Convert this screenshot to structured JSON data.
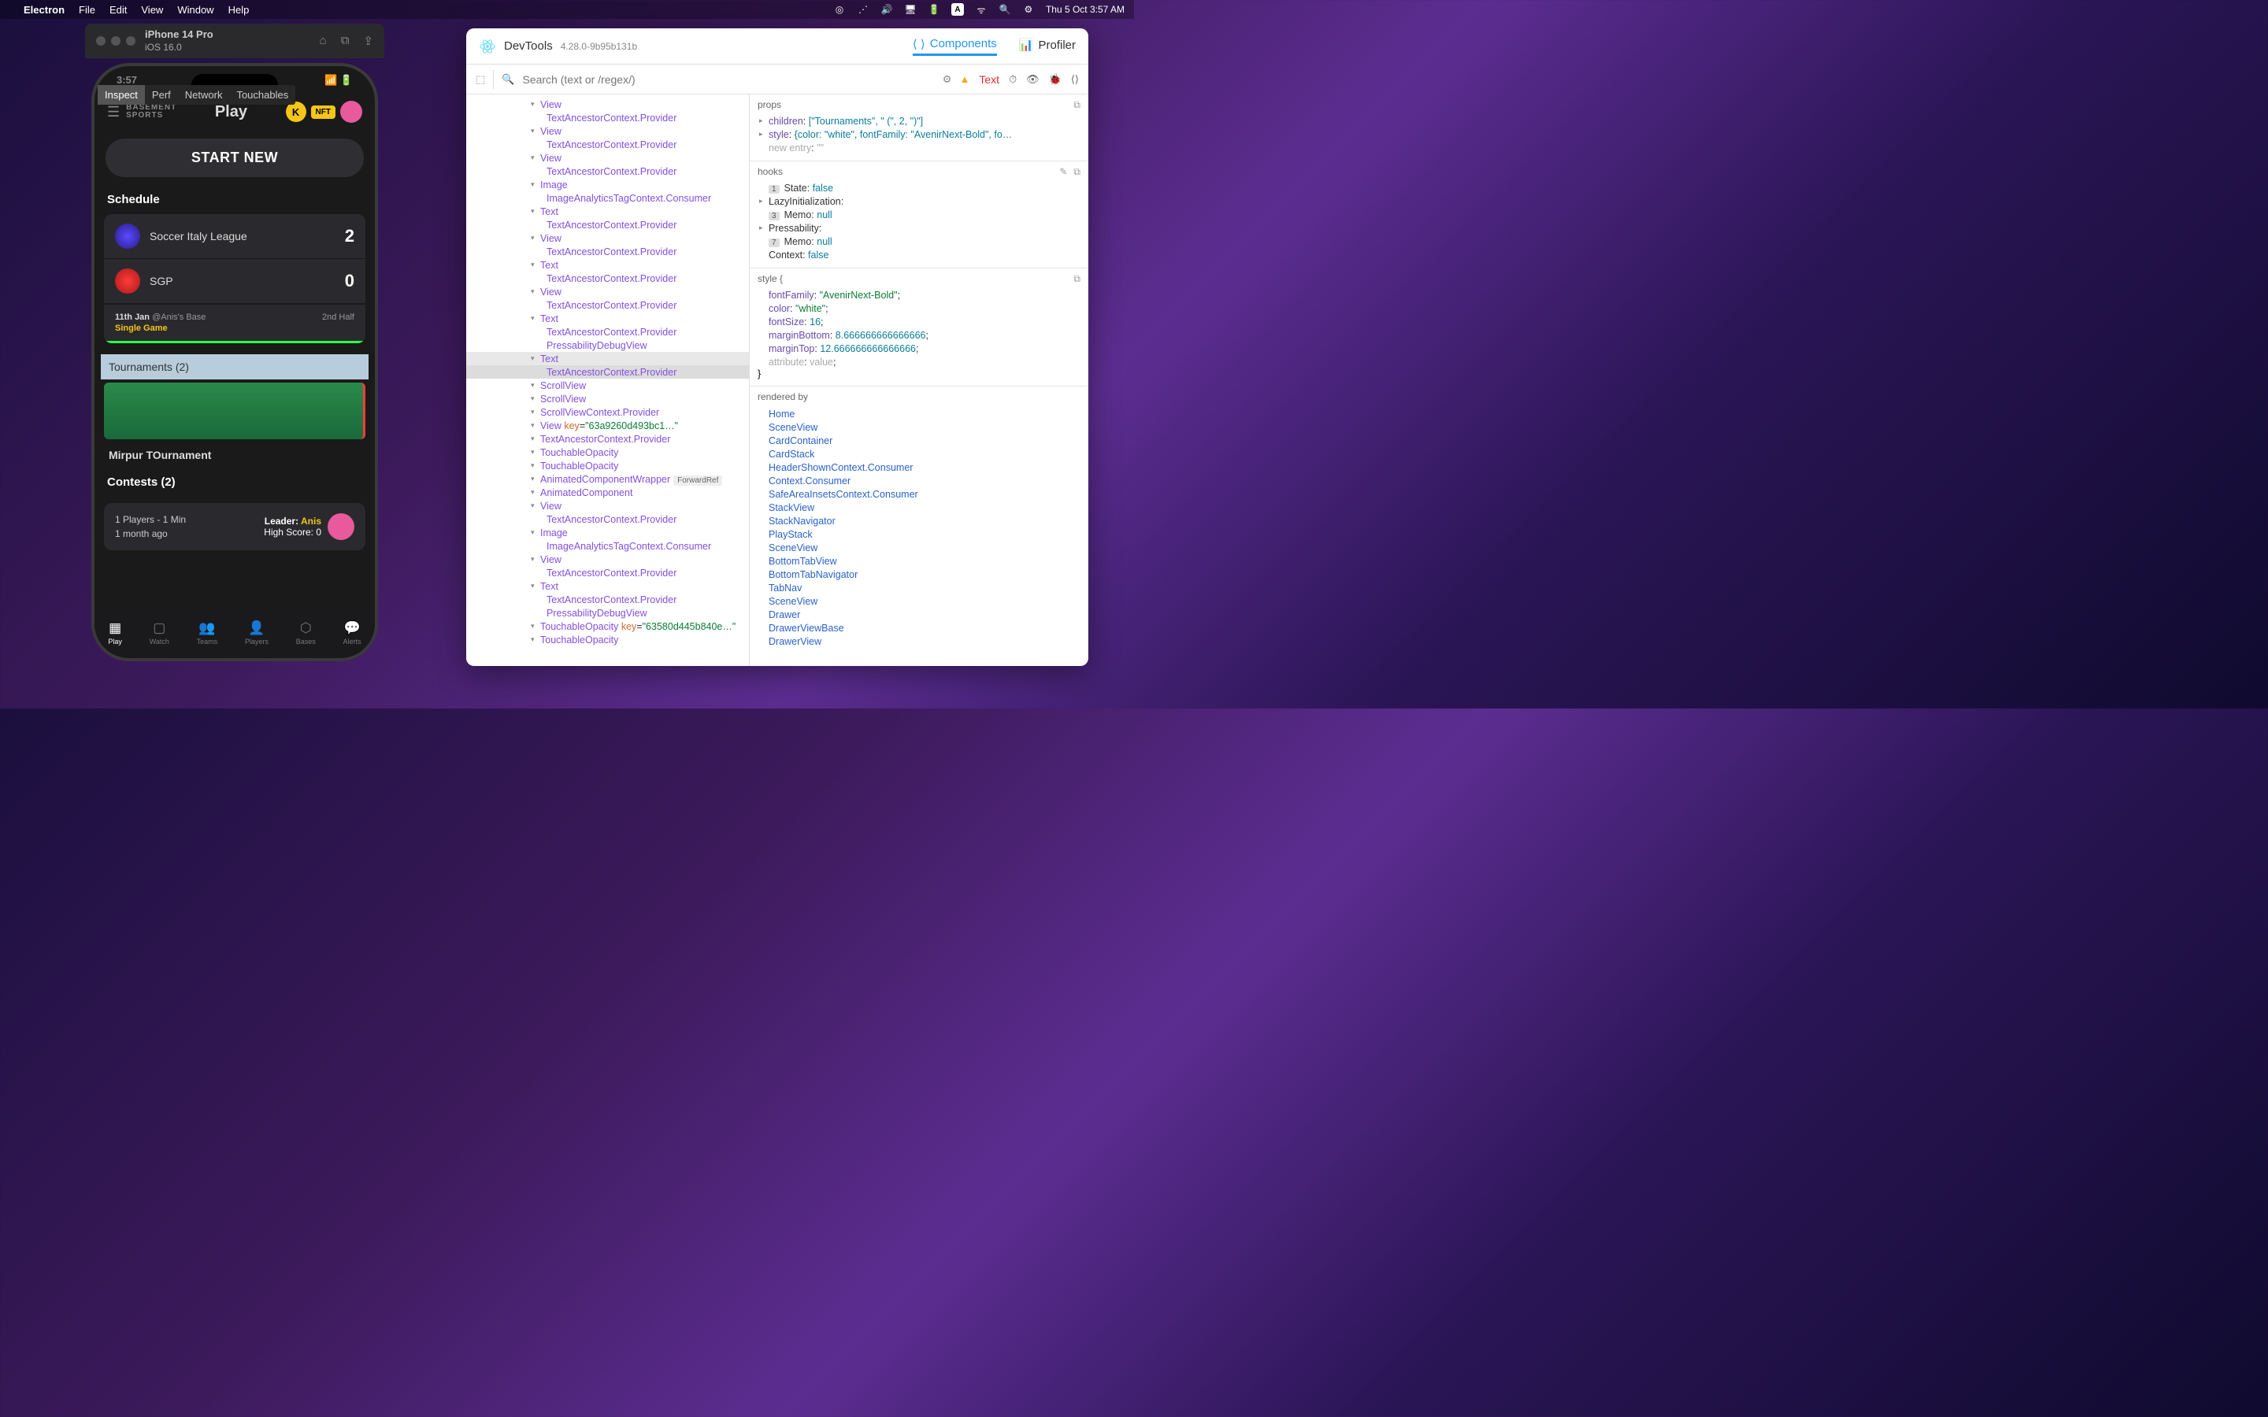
{
  "menubar": {
    "apple": "",
    "app": "Electron",
    "items": [
      "File",
      "Edit",
      "View",
      "Window",
      "Help"
    ],
    "right_date": "Thu 5 Oct  3:57 AM",
    "right_a": "A"
  },
  "simulator": {
    "title": "iPhone 14 Pro",
    "subtitle": "iOS 16.0"
  },
  "phone": {
    "status_time": "3:57",
    "inspect_tabs": [
      "Inspect",
      "Perf",
      "Network",
      "Touchables"
    ],
    "app_logo1": "BASEMENT",
    "app_logo2": "SPORTS",
    "header_title": "Play",
    "nft": "NFT",
    "k": "K",
    "start_new": "START NEW",
    "schedule": "Schedule",
    "team1": "Soccer Italy League",
    "score1": "2",
    "team2": "SGP",
    "score2": "0",
    "match_date": "11th Jan",
    "match_loc": "@Anis's Base",
    "single_game": "Single Game",
    "half": "2nd Half",
    "tournaments": "Tournaments (2)",
    "tourn1": "Mirpur TOurnament",
    "contests": "Contests (2)",
    "contest_line1": "1 Players - 1 Min",
    "contest_line2": "1 month ago",
    "leader_label": "Leader: ",
    "leader_name": "Anis",
    "hs_label": "High Score: ",
    "hs_val": "0",
    "nav": [
      "Play",
      "Watch",
      "Teams",
      "Players",
      "Bases",
      "Alerts"
    ]
  },
  "devtools": {
    "title": "DevTools",
    "version": "4.28.0-9b95b131b",
    "tabs": {
      "components": "Components",
      "profiler": "Profiler"
    },
    "search_placeholder": "Search (text or /regex/)",
    "selected": "Text",
    "tree": [
      {
        "t": "View",
        "i": 0
      },
      {
        "t": "TextAncestorContext.Provider",
        "i": 1,
        "leaf": true
      },
      {
        "t": "View",
        "i": 0
      },
      {
        "t": "TextAncestorContext.Provider",
        "i": 1,
        "leaf": true
      },
      {
        "t": "View",
        "i": 0
      },
      {
        "t": "TextAncestorContext.Provider",
        "i": 1,
        "leaf": true
      },
      {
        "t": "Image",
        "i": 0
      },
      {
        "t": "ImageAnalyticsTagContext.Consumer",
        "i": 1,
        "leaf": true
      },
      {
        "t": "Text",
        "i": 0
      },
      {
        "t": "TextAncestorContext.Provider",
        "i": 1,
        "leaf": true
      },
      {
        "t": "View",
        "i": 0
      },
      {
        "t": "TextAncestorContext.Provider",
        "i": 1,
        "leaf": true
      },
      {
        "t": "Text",
        "i": 0
      },
      {
        "t": "TextAncestorContext.Provider",
        "i": 1,
        "leaf": true
      },
      {
        "t": "View",
        "i": 0
      },
      {
        "t": "TextAncestorContext.Provider",
        "i": 1,
        "leaf": true
      },
      {
        "t": "Text",
        "i": 0
      },
      {
        "t": "TextAncestorContext.Provider",
        "i": 1,
        "leaf": true
      },
      {
        "t": "PressabilityDebugView",
        "i": 1,
        "leaf": true
      },
      {
        "t": "Text",
        "i": 0,
        "sel": true
      },
      {
        "t": "TextAncestorContext.Provider",
        "i": 1,
        "leaf": true,
        "sel2": true
      },
      {
        "t": "ScrollView",
        "i": 0
      },
      {
        "t": "ScrollView",
        "i": 0
      },
      {
        "t": "ScrollViewContext.Provider",
        "i": 0
      },
      {
        "t": "View",
        "i": 0,
        "key": "\"63a9260d493bc1…\""
      },
      {
        "t": "TextAncestorContext.Provider",
        "i": 0
      },
      {
        "t": "TouchableOpacity",
        "i": 0
      },
      {
        "t": "TouchableOpacity",
        "i": 0
      },
      {
        "t": "AnimatedComponentWrapper",
        "i": 0,
        "fwd": true
      },
      {
        "t": "AnimatedComponent",
        "i": 0
      },
      {
        "t": "View",
        "i": 0
      },
      {
        "t": "TextAncestorContext.Provider",
        "i": 1,
        "leaf": true
      },
      {
        "t": "Image",
        "i": 0
      },
      {
        "t": "ImageAnalyticsTagContext.Consumer",
        "i": 1,
        "leaf": true
      },
      {
        "t": "View",
        "i": 0
      },
      {
        "t": "TextAncestorContext.Provider",
        "i": 1,
        "leaf": true
      },
      {
        "t": "Text",
        "i": 0
      },
      {
        "t": "TextAncestorContext.Provider",
        "i": 1,
        "leaf": true
      },
      {
        "t": "PressabilityDebugView",
        "i": 1,
        "leaf": true
      },
      {
        "t": "TouchableOpacity",
        "i": 0,
        "key": "\"63580d445b840e…\""
      },
      {
        "t": "TouchableOpacity",
        "i": 0
      }
    ],
    "props": {
      "header": "props",
      "children_label": "children",
      "children_val": "[\"Tournaments\", \" (\", 2, \")\"]",
      "style_label": "style",
      "style_val": "{color: \"white\", fontFamily: \"AvenirNext-Bold\", fo…",
      "new_entry": "new entry",
      "new_entry_val": "\"\""
    },
    "hooks": {
      "header": "hooks",
      "rows": [
        {
          "n": "1",
          "k": "State",
          "v": "false"
        },
        {
          "k": "LazyInitialization",
          "v": ":",
          "caret": true
        },
        {
          "n": "3",
          "k": "Memo",
          "v": "null"
        },
        {
          "k": "Pressability",
          "v": ":",
          "caret": true
        },
        {
          "n": "7",
          "k": "Memo",
          "v": "null"
        },
        {
          "k": "Context",
          "v": "false"
        }
      ]
    },
    "style": {
      "header": "style {",
      "footer": "}",
      "rows": [
        {
          "k": "fontFamily",
          "v": "\"AvenirNext-Bold\"",
          "str": true
        },
        {
          "k": "color",
          "v": "\"white\"",
          "str": true
        },
        {
          "k": "fontSize",
          "v": "16"
        },
        {
          "k": "marginBottom",
          "v": "8.666666666666666"
        },
        {
          "k": "marginTop",
          "v": "12.666666666666666"
        },
        {
          "k": "attribute",
          "v": "value",
          "muted": true
        }
      ]
    },
    "rendered": {
      "header": "rendered by",
      "list": [
        "Home",
        "SceneView",
        "CardContainer",
        "CardStack",
        "HeaderShownContext.Consumer",
        "Context.Consumer",
        "SafeAreaInsetsContext.Consumer",
        "StackView",
        "StackNavigator",
        "PlayStack",
        "SceneView",
        "BottomTabView",
        "BottomTabNavigator",
        "TabNav",
        "SceneView",
        "Drawer",
        "DrawerViewBase",
        "DrawerView"
      ]
    }
  }
}
